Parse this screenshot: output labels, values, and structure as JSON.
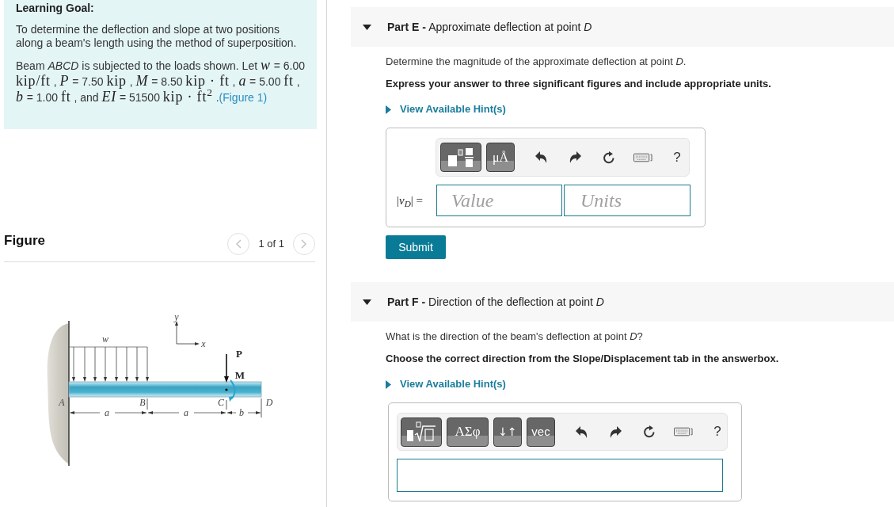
{
  "learning_goal": {
    "heading": "Learning Goal:",
    "paragraphs": [
      [
        {
          "kind": "text",
          "text": "To determine the deflection and slope at two positions along a beam's length using the method of superposition."
        }
      ],
      [
        {
          "kind": "text",
          "text": "Beam *ABCD* is subjected to the loads shown. Let "
        },
        {
          "kind": "math",
          "text": "*w*"
        },
        {
          "kind": "text",
          "text": " = 6.00 "
        },
        {
          "kind": "math",
          "text": "kip/ft"
        },
        {
          "kind": "text",
          "text": " , "
        },
        {
          "kind": "math",
          "text": "*P*"
        },
        {
          "kind": "text",
          "text": " = 7.50 "
        },
        {
          "kind": "math",
          "text": "kip"
        },
        {
          "kind": "text",
          "text": " , "
        },
        {
          "kind": "math",
          "text": "*M*"
        },
        {
          "kind": "text",
          "text": " = 8.50 "
        },
        {
          "kind": "math",
          "text": "kip · ft"
        },
        {
          "kind": "text",
          "text": " , "
        },
        {
          "kind": "math",
          "text": "*a*"
        },
        {
          "kind": "text",
          "text": " = 5.00 "
        },
        {
          "kind": "math",
          "text": "ft"
        },
        {
          "kind": "text",
          "text": " , "
        },
        {
          "kind": "math",
          "text": "*b*"
        },
        {
          "kind": "text",
          "text": " = 1.00 "
        },
        {
          "kind": "math",
          "text": "ft"
        },
        {
          "kind": "text",
          "text": " , and "
        },
        {
          "kind": "math",
          "text": "*EI*"
        },
        {
          "kind": "text",
          "text": " = 51500 "
        },
        {
          "kind": "math",
          "text": "kip · ft$^{2}$"
        },
        {
          "kind": "text",
          "text": " ."
        },
        {
          "kind": "link",
          "text": "(Figure 1)"
        }
      ]
    ]
  },
  "figure": {
    "title": "Figure",
    "pager": {
      "label": "1 of 1",
      "previous_disabled": true,
      "next_disabled": true
    },
    "axis_labels": [
      "y",
      "x"
    ],
    "load_labels": [
      "w",
      "P",
      "M"
    ],
    "point_labels": [
      "A",
      "B",
      "C",
      "D"
    ],
    "dimension_labels": [
      "a",
      "a",
      "b"
    ]
  },
  "parts": [
    {
      "title": "**Part E -** Approximate deflection at point *D*",
      "expanded": true,
      "prompt": "Determine the magnitude of the approximate deflection at point *D*.",
      "instruction": "Express your answer to three significant figures and include appropriate units.",
      "hint": {
        "label": "View Available Hint(s)",
        "expanded": false
      },
      "answer": {
        "kind": "value_units",
        "toolbar": [
          {
            "kind": "fraction_template"
          },
          {
            "kind": "units",
            "text": "μÅ"
          },
          {
            "kind": "undo"
          },
          {
            "kind": "redo"
          },
          {
            "kind": "reset"
          },
          {
            "kind": "keyboard"
          },
          {
            "kind": "help",
            "text": "?"
          }
        ],
        "label": "|*v*$_{D}$| =",
        "value_placeholder": "Value",
        "units_placeholder": "Units"
      },
      "submit": "Submit"
    },
    {
      "title": "**Part F -** Direction of the deflection at point *D*",
      "expanded": true,
      "prompt": "What is the direction of the beam's deflection at point *D*?",
      "instruction": "Choose the correct direction from the Slope/Displacement tab in the answerbox.",
      "hint": {
        "label": "View Available Hint(s)",
        "expanded": false
      },
      "answer": {
        "kind": "text_entry",
        "toolbar": [
          {
            "kind": "radical_template"
          },
          {
            "kind": "greek",
            "text": "ΑΣφ"
          },
          {
            "kind": "arrows",
            "text": "↓↑"
          },
          {
            "kind": "vector",
            "text": "vec"
          },
          {
            "kind": "undo"
          },
          {
            "kind": "redo"
          },
          {
            "kind": "reset"
          },
          {
            "kind": "keyboard"
          },
          {
            "kind": "help",
            "text": "?"
          }
        ]
      }
    }
  ]
}
